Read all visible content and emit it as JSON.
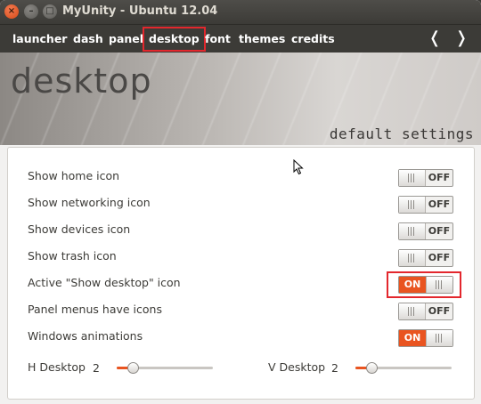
{
  "window": {
    "title": "MyUnity - Ubuntu 12.04",
    "close_glyph": "×",
    "minimize_glyph": "–",
    "maximize_glyph": "□"
  },
  "tabs": [
    {
      "label": "launcher"
    },
    {
      "label": "dash"
    },
    {
      "label": "panel"
    },
    {
      "label": "desktop",
      "active": true
    },
    {
      "label": "font"
    },
    {
      "label": "themes"
    },
    {
      "label": "credits"
    }
  ],
  "nav": {
    "prev": "❬",
    "next": "❭"
  },
  "banner": {
    "title": "desktop",
    "subtitle": "default settings"
  },
  "settings": [
    {
      "label": "Show home icon",
      "state": "OFF"
    },
    {
      "label": "Show networking icon",
      "state": "OFF"
    },
    {
      "label": "Show devices icon",
      "state": "OFF"
    },
    {
      "label": "Show trash icon",
      "state": "OFF"
    },
    {
      "label": "Active \"Show desktop\" icon",
      "state": "ON"
    },
    {
      "label": "Panel menus have icons",
      "state": "OFF"
    },
    {
      "label": "Windows animations",
      "state": "ON"
    }
  ],
  "sliders": {
    "h": {
      "label": "H Desktop",
      "value": "2"
    },
    "v": {
      "label": "V Desktop",
      "value": "2"
    }
  },
  "colors": {
    "accent": "#e95420",
    "highlight": "#e3272d",
    "titlebar": "#3c3b37"
  }
}
